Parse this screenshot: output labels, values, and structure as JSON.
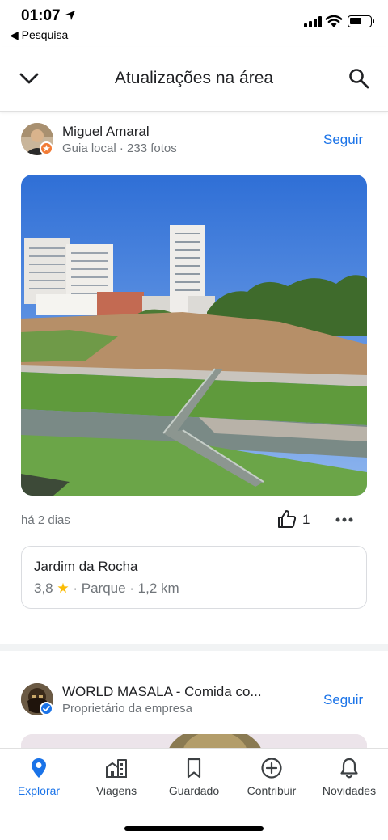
{
  "status_bar": {
    "time": "01:07",
    "back_label": "◀ Pesquisa"
  },
  "header": {
    "title": "Atualizações na área"
  },
  "posts": [
    {
      "author": "Miguel Amaral",
      "meta": "Guia local · 233 fotos",
      "follow_label": "Seguir",
      "time_ago": "há 2 dias",
      "likes": "1",
      "place": {
        "name": "Jardim da Rocha",
        "rating": "3,8",
        "star": "★",
        "details": "· Parque · 1,2 km"
      }
    },
    {
      "author": "WORLD MASALA - Comida co...",
      "meta": "Proprietário da empresa",
      "follow_label": "Seguir"
    }
  ],
  "bottom_nav": [
    {
      "label": "Explorar",
      "icon": "location-pin-icon",
      "active": true
    },
    {
      "label": "Viagens",
      "icon": "buildings-icon",
      "active": false
    },
    {
      "label": "Guardado",
      "icon": "bookmark-icon",
      "active": false
    },
    {
      "label": "Contribuir",
      "icon": "add-circle-icon",
      "active": false
    },
    {
      "label": "Novidades",
      "icon": "bell-icon",
      "active": false
    }
  ],
  "colors": {
    "accent": "#1a73e8",
    "star": "#fbbc04",
    "secondary_text": "#70757a"
  }
}
